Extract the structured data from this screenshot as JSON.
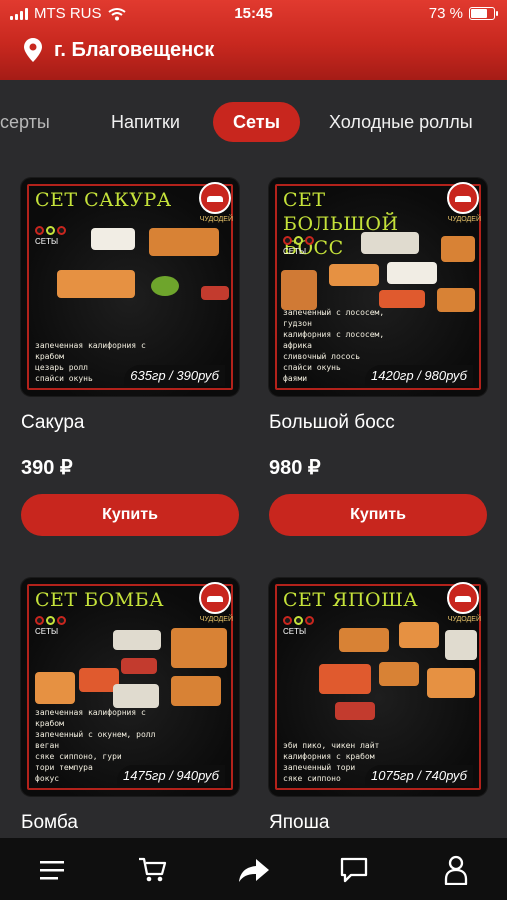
{
  "status": {
    "carrier": "MTS RUS",
    "time": "15:45",
    "battery_text": "73 %",
    "battery_level": 0.73
  },
  "header": {
    "location": "г. Благовещенск"
  },
  "tabs": [
    {
      "label": "серты",
      "active": false
    },
    {
      "label": "Напитки",
      "active": false
    },
    {
      "label": "Сеты",
      "active": true
    },
    {
      "label": "Холодные роллы",
      "active": false
    }
  ],
  "products": [
    {
      "image_title": "СЕТ САКУРА",
      "image_desc": [
        "запеченная калифорния с крабом",
        "цезарь ролл",
        "спайси окунь"
      ],
      "image_weight": "635гр / 390руб",
      "name": "Сакура",
      "price": "390 ₽",
      "buy_label": "Купить"
    },
    {
      "image_title": "СЕТ БОЛЬШОЙ БОСС",
      "image_desc": [
        "запеченный с лососем, гудзон",
        "калифорния с лососем, африка",
        "сливочный лосось",
        "спайси окунь",
        "фаями"
      ],
      "image_weight": "1420гр / 980руб",
      "name": "Большой босс",
      "price": "980 ₽",
      "buy_label": "Купить"
    },
    {
      "image_title": "СЕТ БОМБА",
      "image_desc": [
        "запеченная калифорния с крабом",
        "запеченный с окунем, ролл веган",
        "сяке сиппоно, гури",
        "тори темпура",
        "фокус"
      ],
      "image_weight": "1475гр / 940руб",
      "name": "Бомба"
    },
    {
      "image_title": "СЕТ ЯПОША",
      "image_desc": [
        "эби пико, чикен лайт",
        "калифорния с крабом",
        "запеченный тори",
        "сяке сиппоно"
      ],
      "image_weight": "1075гр / 740руб",
      "name": "Япоша"
    }
  ],
  "image_badge": {
    "logo_caption": "ЧУДОДЕЙ",
    "sets_label": "СЕТЫ"
  },
  "bottom_nav": [
    {
      "icon": "menu-icon"
    },
    {
      "icon": "cart-icon"
    },
    {
      "icon": "share-icon"
    },
    {
      "icon": "chat-icon"
    },
    {
      "icon": "profile-icon"
    }
  ],
  "colors": {
    "accent_red": "#c8261e",
    "header_red": "#d3332a",
    "title_green": "#c5e23a",
    "background": "#2b2b2d",
    "navbar": "#0f0f0f"
  }
}
